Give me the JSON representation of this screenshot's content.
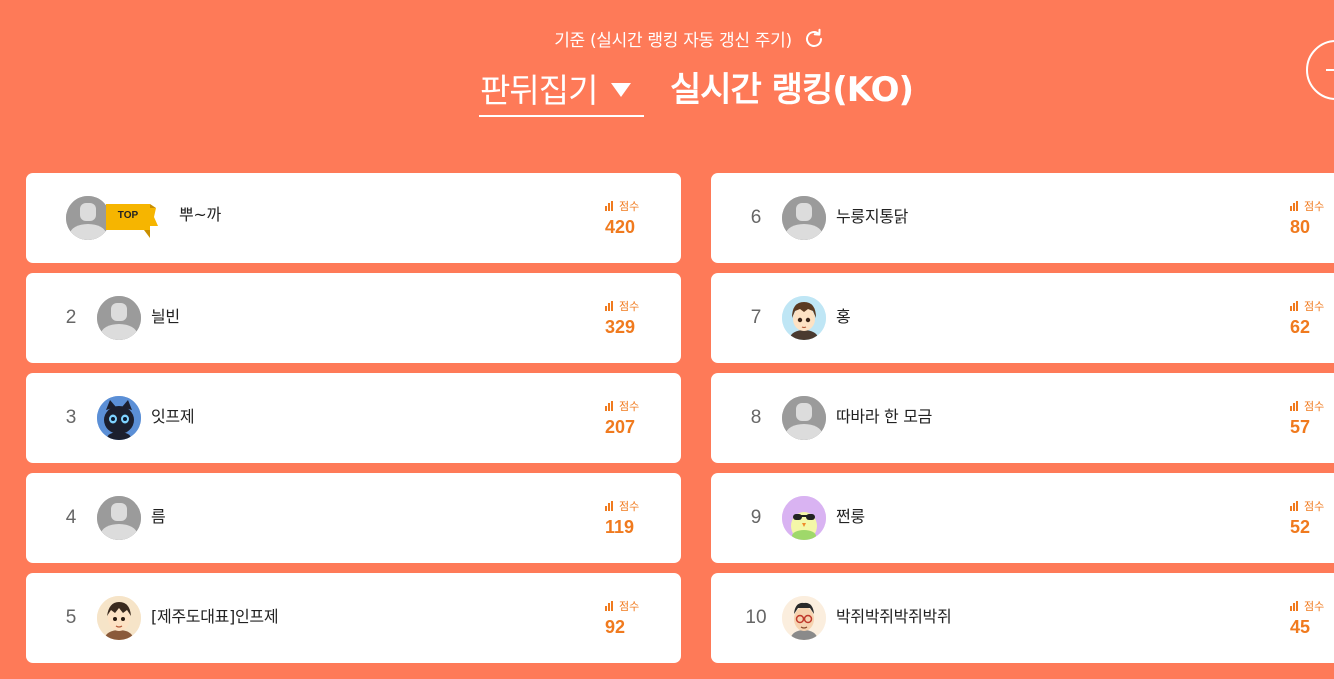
{
  "header": {
    "criteria_text": "기준 (실시간 랭킹 자동 갱신 주기)",
    "game_select": "판뒤집기",
    "ranking_title": "실시간 랭킹(KO)"
  },
  "score_label": "점수",
  "top_badge": "TOP",
  "colors": {
    "background": "#FE7A58",
    "card": "#FFFFFF",
    "score": "#F07A1E",
    "rank_text": "#666666"
  },
  "rankings": [
    {
      "rank": "1",
      "name": "뿌~까",
      "score": "420",
      "avatar": "default-avatar-icon",
      "top": true
    },
    {
      "rank": "2",
      "name": "늴빈",
      "score": "329",
      "avatar": "default-avatar-icon"
    },
    {
      "rank": "3",
      "name": "잇프제",
      "score": "207",
      "avatar": "black-cat-avatar"
    },
    {
      "rank": "4",
      "name": "름",
      "score": "119",
      "avatar": "default-avatar-icon"
    },
    {
      "rank": "5",
      "name": "[제주도대표]인프제",
      "score": "92",
      "avatar": "cartoon-boy-avatar"
    },
    {
      "rank": "6",
      "name": "누룽지통닭",
      "score": "80",
      "avatar": "default-avatar-icon"
    },
    {
      "rank": "7",
      "name": "홍",
      "score": "62",
      "avatar": "cartoon-boy-avatar"
    },
    {
      "rank": "8",
      "name": "따바라 한 모금",
      "score": "57",
      "avatar": "default-avatar-icon"
    },
    {
      "rank": "9",
      "name": "쩐룽",
      "score": "52",
      "avatar": "bird-sunglasses-avatar"
    },
    {
      "rank": "10",
      "name": "박쥐박쥐박쥐박쥐",
      "score": "45",
      "avatar": "glasses-man-avatar"
    }
  ]
}
